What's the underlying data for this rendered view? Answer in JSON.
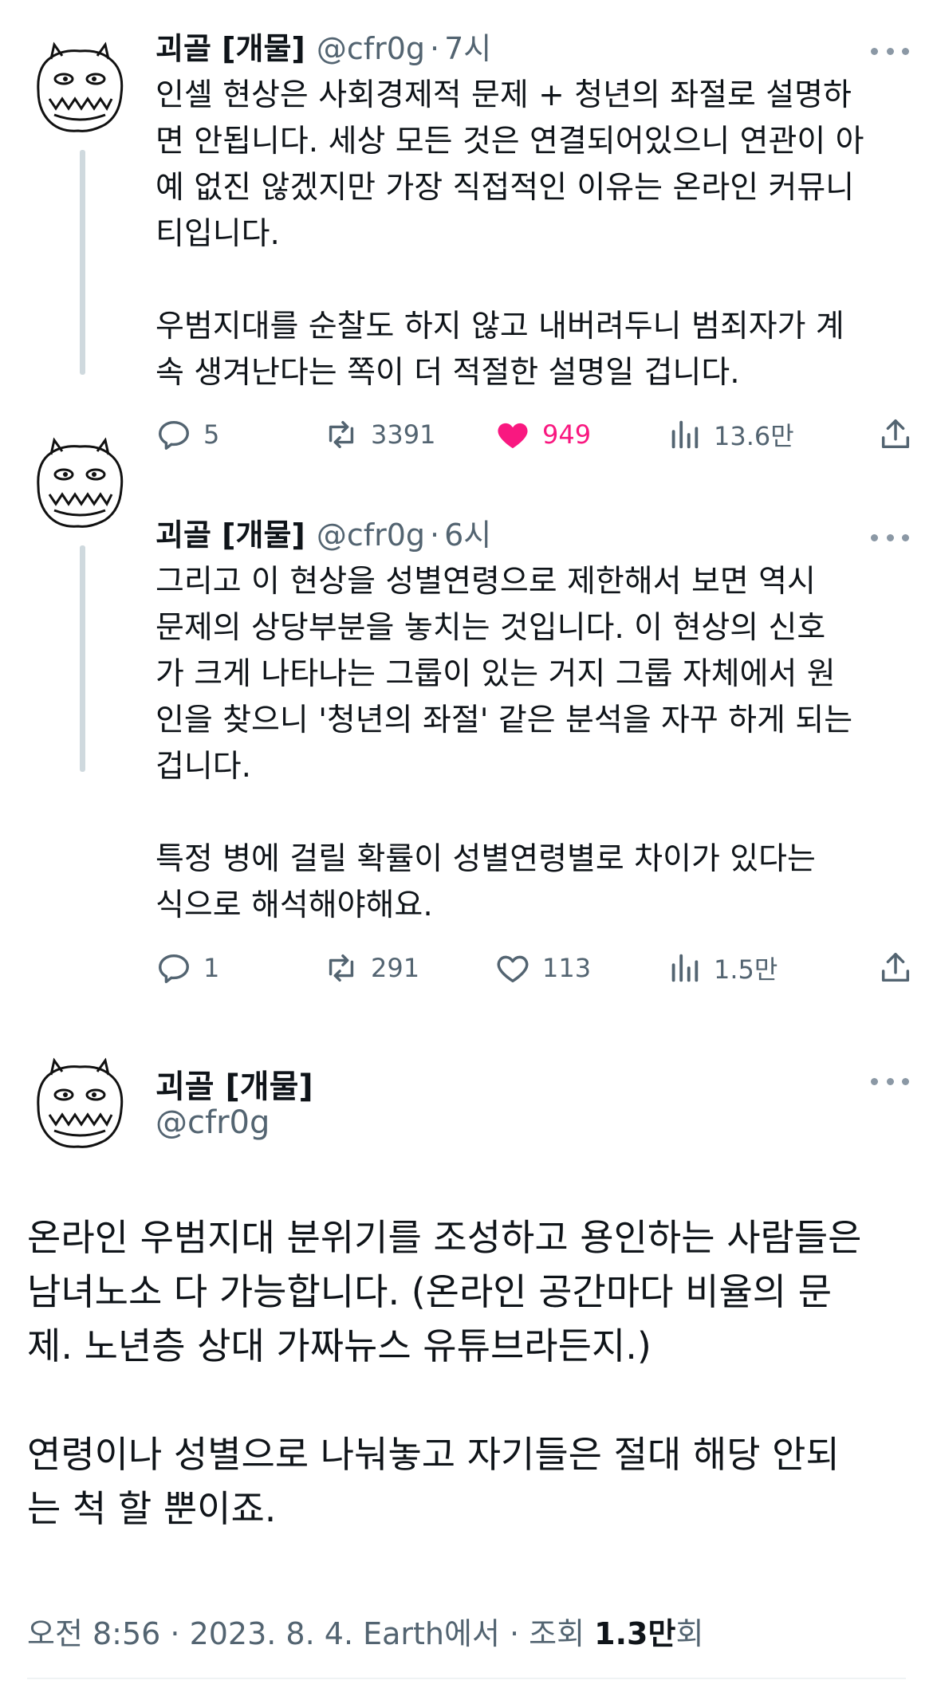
{
  "colors": {
    "accent_like": "#f91880",
    "text": "#0f1419",
    "muted": "#536471",
    "thread_line": "#cfd9de"
  },
  "tweets": [
    {
      "name": "괴골 [개물]",
      "handle": "@cfr0g",
      "dot": "·",
      "time": "7시",
      "text": "인셀 현상은 사회경제적 문제 + 청년의 좌절로 설명하\n면 안됩니다. 세상 모든 것은 연결되어있으니 연관이 아\n예 없진 않겠지만 가장 직접적인 이유는 온라인 커뮤니\n티입니다.\n\n우범지대를 순찰도 하지 않고 내버려두니 범죄자가 계\n속 생겨난다는 쪽이 더 적절한 설명일 겁니다.",
      "replies": "5",
      "retweets": "3391",
      "likes": "949",
      "liked": true,
      "views": "13.6만"
    },
    {
      "name": "괴골 [개물]",
      "handle": "@cfr0g",
      "dot": "·",
      "time": "6시",
      "text": "그리고 이 현상을 성별연령으로 제한해서 보면 역시\n문제의 상당부분을 놓치는 것입니다. 이 현상의 신호\n가 크게 나타나는 그룹이 있는 거지 그룹 자체에서 원\n인을 찾으니 '청년의 좌절' 같은 분석을 자꾸 하게 되는\n겁니다.\n\n특정 병에 걸릴 확률이 성별연령별로 차이가 있다는\n식으로 해석해야해요.",
      "replies": "1",
      "retweets": "291",
      "likes": "113",
      "liked": false,
      "views": "1.5만"
    }
  ],
  "main_tweet": {
    "name": "괴골 [개물]",
    "handle": "@cfr0g",
    "text": "온라인 우범지대 분위기를 조성하고 용인하는 사람들은\n남녀노소 다 가능합니다. (온라인 공간마다 비율의 문\n제. 노년층 상대 가짜뉴스 유튜브라든지.)\n\n연령이나 성별으로 나눠놓고 자기들은 절대 해당 안되\n는 척 할 뿐이죠.",
    "meta_prefix": "오전 8:56 · 2023. 8. 4. Earth에서 · 조회 ",
    "views": "1.3만",
    "views_suffix": "회"
  },
  "icons": {
    "reply": "reply-icon",
    "retweet": "retweet-icon",
    "like": "heart-icon",
    "views": "views-icon",
    "share": "share-icon",
    "more": "more-icon"
  }
}
